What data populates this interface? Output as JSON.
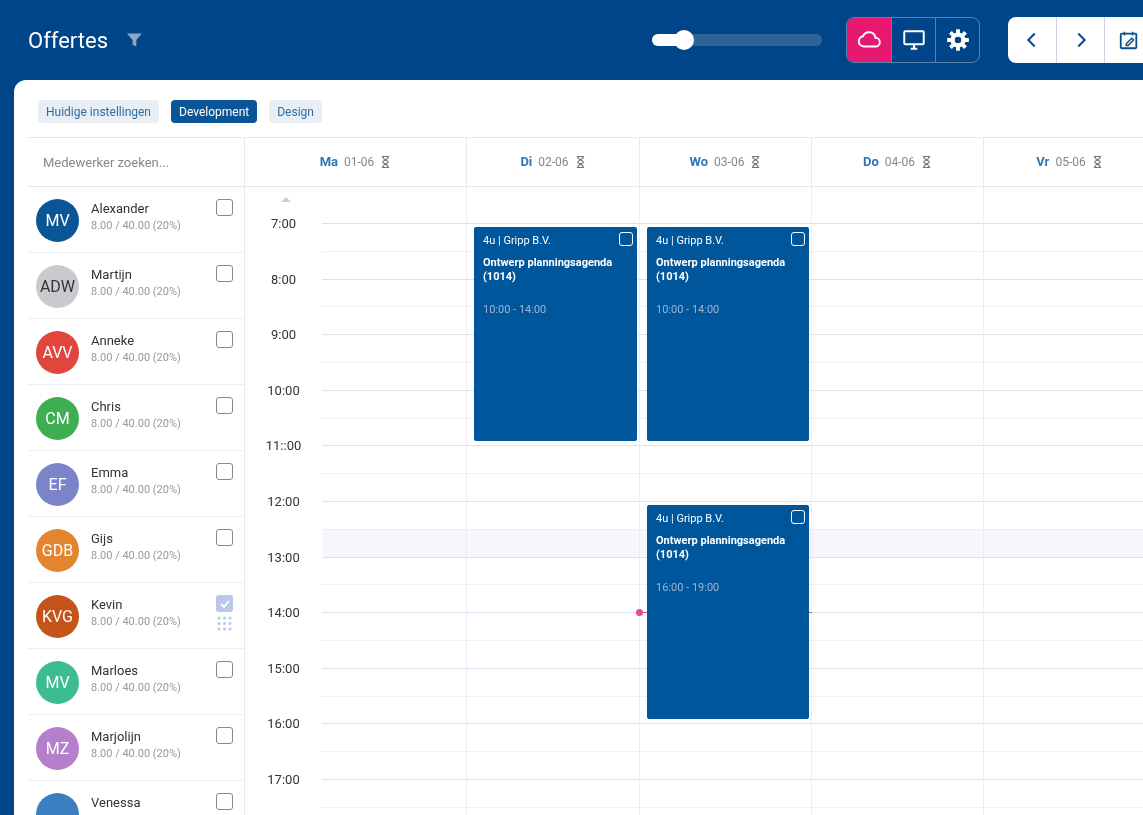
{
  "header": {
    "title": "Offertes",
    "zoom_slider": {
      "level": 0.19
    },
    "view_buttons": [
      {
        "kind": "cloud",
        "selected": true
      },
      {
        "kind": "monitor",
        "selected": false
      },
      {
        "kind": "settings",
        "selected": false
      }
    ],
    "nav_buttons": [
      {
        "kind": "prev"
      },
      {
        "kind": "next"
      },
      {
        "kind": "calendar"
      }
    ]
  },
  "filter_tags": [
    {
      "label": "Huidige instellingen",
      "selected": false
    },
    {
      "label": "Development",
      "selected": true
    },
    {
      "label": "Design",
      "selected": false
    }
  ],
  "employee_search": {
    "placeholder": "Medewerker zoeken..."
  },
  "employees": [
    {
      "initials": "MV",
      "name": "Alexander",
      "hours": "8.00 / 40.00 (20%)",
      "color": "#0a5596",
      "checked": false
    },
    {
      "initials": "ADW",
      "name": "Martijn",
      "hours": "8.00 / 40.00 (20%)",
      "color": "#c8cacd",
      "checked": false
    },
    {
      "initials": "AVV",
      "name": "Anneke",
      "hours": "8.00 / 40.00 (20%)",
      "color": "#e0463d",
      "checked": false
    },
    {
      "initials": "CM",
      "name": "Chris",
      "hours": "8.00 / 40.00 (20%)",
      "color": "#3fae53",
      "checked": false
    },
    {
      "initials": "EF",
      "name": "Emma",
      "hours": "8.00 / 40.00 (20%)",
      "color": "#7b84c9",
      "checked": false
    },
    {
      "initials": "GDB",
      "name": "Gijs",
      "hours": "8.00 / 40.00 (20%)",
      "color": "#e3852f",
      "checked": false
    },
    {
      "initials": "KVG",
      "name": "Kevin",
      "hours": "8.00 / 40.00 (20%)",
      "color": "#c4541a",
      "checked": true
    },
    {
      "initials": "MV",
      "name": "Marloes",
      "hours": "8.00 / 40.00 (20%)",
      "color": "#3ebc91",
      "checked": false
    },
    {
      "initials": "MZ",
      "name": "Marjolijn",
      "hours": "8.00 / 40.00 (20%)",
      "color": "#b57fcc",
      "checked": false
    },
    {
      "name": "Venessa",
      "color": "#3b7fc0",
      "checked": false
    }
  ],
  "days": [
    {
      "day": "Ma",
      "date": "01-06"
    },
    {
      "day": "Di",
      "date": "02-06",
      "events": [
        {
          "header": "4u | Gripp B.V.",
          "title": "Ontwerp planningsagenda (1014)",
          "time": "10:00 - 14:00",
          "checked": false
        }
      ]
    },
    {
      "day": "Wo",
      "date": "03-06",
      "events": [
        {
          "header": "4u | Gripp B.V.",
          "title": "Ontwerp planningsagenda (1014)",
          "time": "10:00 - 14:00",
          "checked": false
        },
        {
          "header": "4u | Gripp B.V.",
          "title": "Ontwerp planningsagenda (1014)",
          "time": "16:00 - 19:00",
          "checked": false
        }
      ]
    },
    {
      "day": "Do",
      "date": "04-06"
    },
    {
      "day": "Vr",
      "date": "05-06"
    }
  ],
  "hours": [
    "7:00",
    "8:00",
    "9:00",
    "10:00",
    "11::00",
    "12:00",
    "13:00",
    "14:00",
    "15:00",
    "16:00",
    "17:00"
  ]
}
